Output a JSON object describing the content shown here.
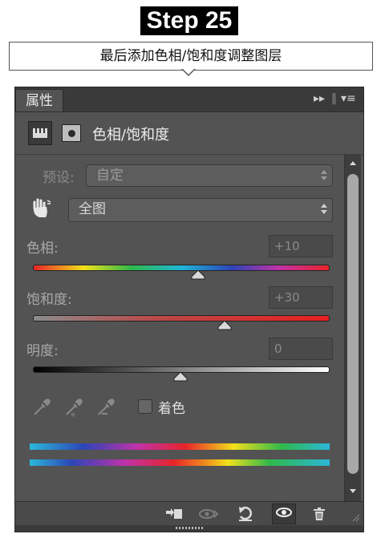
{
  "banner": {
    "step": "Step 25",
    "callout": "最后添加色相/饱和度调整图层"
  },
  "panel": {
    "tab_label": "属性",
    "header_title": "色相/饱和度",
    "preset": {
      "label": "预设:",
      "value": "自定"
    },
    "channel": {
      "value": "全图"
    },
    "hue": {
      "label": "色相:",
      "value": "+10",
      "level": 0.56
    },
    "saturation": {
      "label": "饱和度:",
      "value": "+30",
      "level": 0.65
    },
    "lightness": {
      "label": "明度:",
      "value": "0",
      "level": 0.5
    },
    "colorize": {
      "label": "着色",
      "checked": false
    }
  },
  "icons": {
    "tab_controls": [
      "double-chevron-right-icon",
      "panel-menu-icon"
    ],
    "header": [
      "adjustment-layer-icon",
      "mask-icon"
    ],
    "tools": [
      "hand-target-icon",
      "eyedropper-icon",
      "eyedropper-plus-icon",
      "eyedropper-minus-icon"
    ],
    "footer": [
      "clip-to-layer-icon",
      "view-previous-state-icon",
      "reset-icon",
      "visibility-eye-icon",
      "trash-icon"
    ]
  },
  "colors": {
    "panel_bg": "#535353",
    "tab_bar": "#3a3a3a",
    "text": "#e6e6e6",
    "dim_text": "#a9a9a9"
  }
}
